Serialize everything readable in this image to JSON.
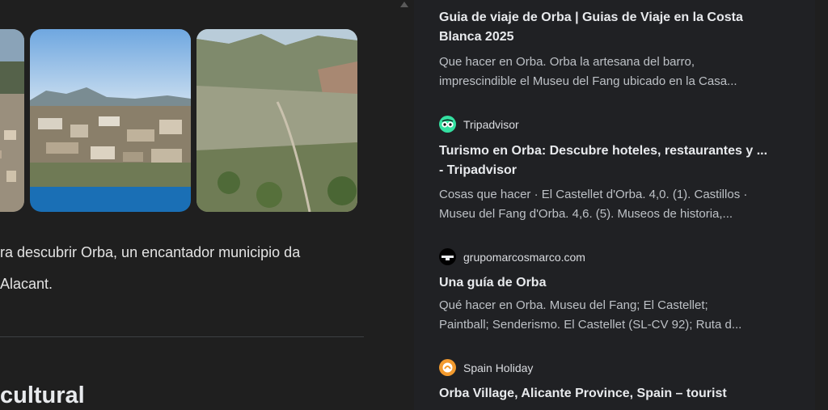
{
  "left": {
    "description_line1": "ra descubrir Orba, un encantador municipio da",
    "description_line2": "Alacant.",
    "section_heading": "cultural"
  },
  "results": [
    {
      "title_line1": "Guia de viaje de Orba | Guias de Viaje en la Costa",
      "title_line2": "Blanca 2025",
      "snippet_line1": "Que hacer en Orba. Orba la artesana del barro,",
      "snippet_line2": "imprescindible el Museu del Fang ubicado en la Casa..."
    },
    {
      "source": "Tripadvisor",
      "icon": "tripadvisor-owl-icon",
      "title_line1": "Turismo en Orba: Descubre hoteles, restaurantes y ...",
      "title_line2": "- Tripadvisor",
      "snippet_line1": "Cosas que hacer · El Castellet d'Orba. 4,0. (1). Castillos ·",
      "snippet_line2": "Museu del Fang d'Orba. 4,6. (5). Museos de historia,..."
    },
    {
      "source": "grupomarcosmarco.com",
      "icon": "grupomarcos-logo-icon",
      "title_line1": "Una guía de Orba",
      "snippet_line1": "Qué hacer en Orba. Museu del Fang; El Castellet;",
      "snippet_line2": "Paintball; Senderismo. El Castellet (SL-CV 92); Ruta d..."
    },
    {
      "source": "Spain Holiday",
      "icon": "spain-holiday-logo-icon",
      "title_line1": "Orba Village, Alicante Province, Spain – tourist"
    }
  ],
  "colors": {
    "background": "#1f1f1f",
    "panel": "#202124",
    "tripadvisor": "#34e0a1",
    "spain_holiday": "#f29a2e"
  }
}
